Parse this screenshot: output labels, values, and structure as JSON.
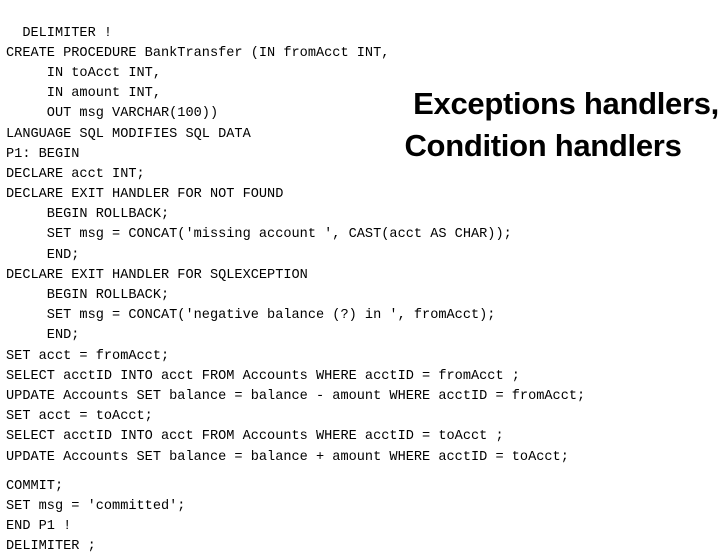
{
  "slide": {
    "background_color": "#ffffff",
    "text_color": "#000000",
    "heading": {
      "line1": "Exceptions handlers,",
      "line2": "Condition handlers"
    },
    "code": {
      "language": "SQL",
      "lines": [
        "  DELIMITER !",
        "CREATE PROCEDURE BankTransfer (IN fromAcct INT,",
        "     IN toAcct INT,",
        "     IN amount INT,",
        "     OUT msg VARCHAR(100))",
        "LANGUAGE SQL MODIFIES SQL DATA",
        "P1: BEGIN",
        "DECLARE acct INT;",
        "DECLARE EXIT HANDLER FOR NOT FOUND",
        "     BEGIN ROLLBACK;",
        "     SET msg = CONCAT('missing account ', CAST(acct AS CHAR));",
        "     END;",
        "DECLARE EXIT HANDLER FOR SQLEXCEPTION",
        "     BEGIN ROLLBACK;",
        "     SET msg = CONCAT('negative balance (?) in ', fromAcct);",
        "     END;",
        "SET acct = fromAcct;",
        "SELECT acctID INTO acct FROM Accounts WHERE acctID = fromAcct ;",
        "UPDATE Accounts SET balance = balance - amount WHERE acctID = fromAcct;",
        "SET acct = toAcct;",
        "SELECT acctID INTO acct FROM Accounts WHERE acctID = toAcct ;",
        "UPDATE Accounts SET balance = balance + amount WHERE acctID = toAcct;",
        "COMMIT;",
        "SET msg = 'committed';",
        "END P1 !",
        "DELIMITER ;"
      ]
    }
  }
}
